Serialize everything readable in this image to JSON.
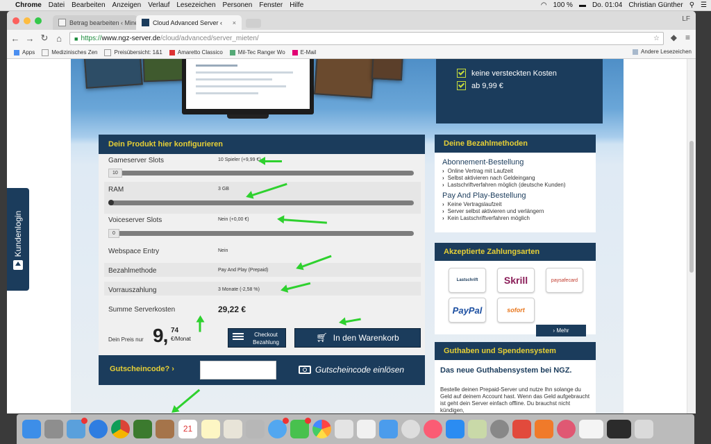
{
  "menubar": {
    "app": "Chrome",
    "items": [
      "Datei",
      "Bearbeiten",
      "Anzeigen",
      "Verlauf",
      "Lesezeichen",
      "Personen",
      "Fenster",
      "Hilfe"
    ],
    "battery": "100 %",
    "clock": "Do. 01:04",
    "user": "Christian Günther"
  },
  "browser": {
    "tabs": [
      {
        "title": "Betrag bearbeiten ‹ Minec",
        "active": false
      },
      {
        "title": "Cloud Advanced Server ‹ ",
        "active": true
      }
    ],
    "profile": "LF",
    "url": {
      "scheme": "https://",
      "host": "www.ngz-server.de",
      "path": "/cloud/advanced/server_mieten/"
    },
    "bookmarks": [
      "Apps",
      "Medizinisches Zen",
      "Preisübersicht: 1&1",
      "Amaretto Classico",
      "Mil-Tec Ranger Wo",
      "E-Mail"
    ],
    "bookmarks_other": "Andere Lesezeichen"
  },
  "promo": {
    "line1": "keine versteckten Kosten",
    "line2": "ab 9,99 €"
  },
  "config": {
    "title": "Dein Produkt hier konfigurieren",
    "rows": [
      {
        "label": "Gameserver Slots",
        "value": "10 Spieler (+9,99 €)",
        "slider_box": "10"
      },
      {
        "label": "RAM",
        "value": "3 GB"
      },
      {
        "label": "Voiceserver Slots",
        "value": "Nein (+0,00 €)",
        "slider_box": "0"
      },
      {
        "label": "Webspace Entry",
        "value": "Nein"
      },
      {
        "label": "Bezahlmethode",
        "value": "Pay And Play (Prepaid)"
      },
      {
        "label": "Vorrauszahlung",
        "value": "3 Monate (-2,58 %)"
      },
      {
        "label": "Summe Serverkosten",
        "value": "29,22 €"
      }
    ],
    "price": {
      "label": "Dein Preis nur",
      "euros": "9,",
      "cents": "74",
      "unit": "€/Monat"
    },
    "checkout_line1": "Checkout",
    "checkout_line2": "Bezahlung",
    "cart_button": "In den Warenkorb",
    "voucher_label": "Gutscheincode?",
    "voucher_value": "",
    "voucher_button": "Gutscheincode einlösen"
  },
  "sidebar": {
    "payment_methods": {
      "title": "Deine Bezahlmethoden",
      "subscription_title": "Abonnement-Bestellung",
      "subscription_items": [
        "Online Vertrag mit Laufzeit",
        "Selbst aktivieren nach Geldeingang",
        "Lastschriftverfahren möglich (deutsche Kunden)"
      ],
      "payandplay_title": "Pay And Play-Bestellung",
      "payandplay_items": [
        "Keine Vertragslaufzeit",
        "Server selbst aktivieren und verlängern",
        "Kein Lastschriftverfahren möglich"
      ]
    },
    "accepted": {
      "title": "Akzeptierte Zahlungsarten",
      "methods": [
        "Lastschrift",
        "Skrill",
        "paysafecard",
        "PayPal",
        "sofort"
      ],
      "more_button": "Mehr"
    },
    "credit": {
      "title": "Guthaben und Spendensystem",
      "headline": "Das neue Guthabensystem bei NGZ.",
      "text": "Bestelle deinen Prepaid-Server und nutze Ihn solange du Geld auf deinem Account hast. Wenn das Geld aufgebraucht ist geht dein Server einfach offline. Du brauchst nicht kündigen,"
    }
  },
  "kundenlogin": "Kundenlogin",
  "colors": {
    "navy": "#1b3c5c",
    "yellow": "#e6cf36",
    "arrow": "#2ed12e"
  }
}
